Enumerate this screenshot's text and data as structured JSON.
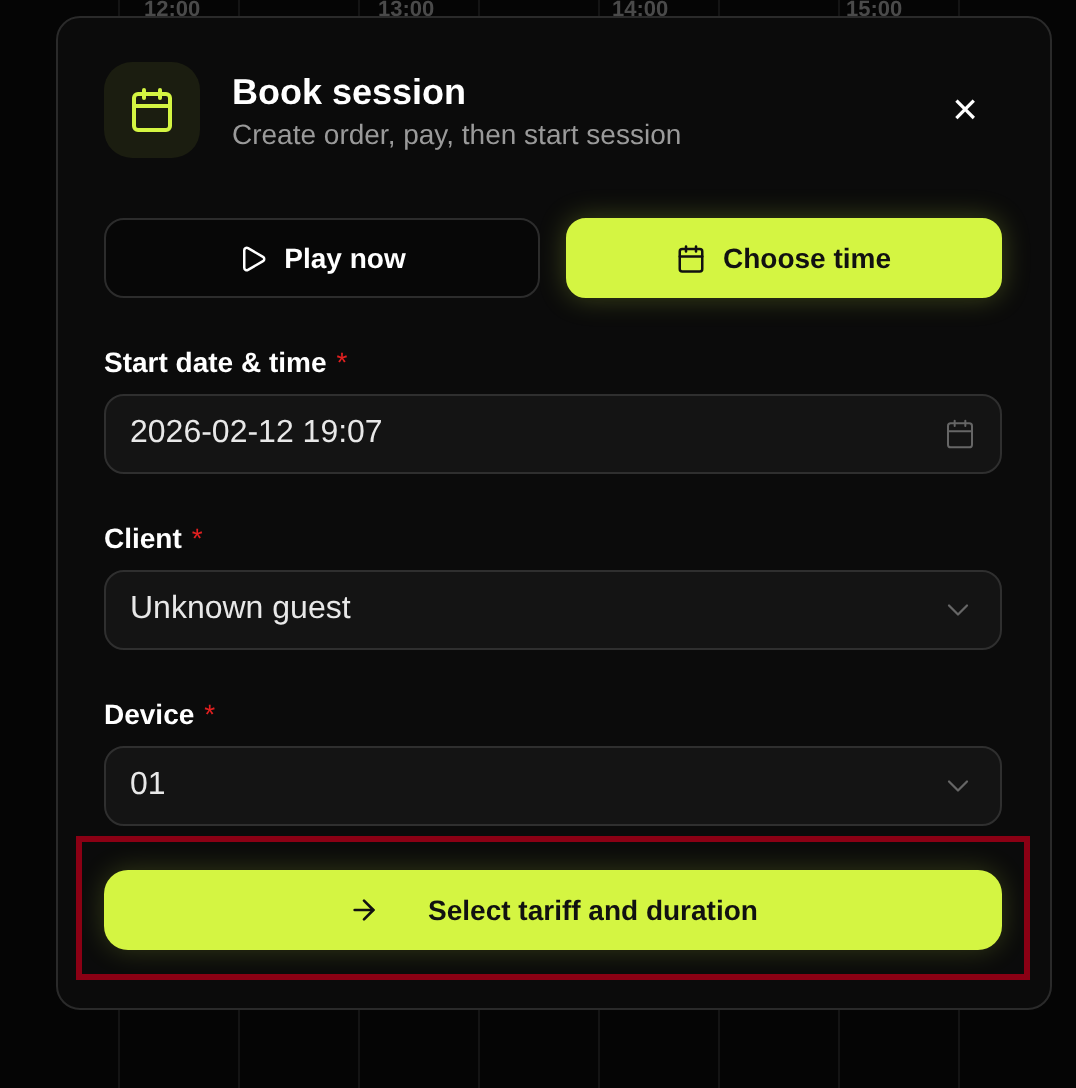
{
  "timeline": [
    "12:00",
    "13:00",
    "14:00",
    "15:00"
  ],
  "dialog": {
    "title": "Book session",
    "subtitle": "Create order, pay, then start session",
    "close": "×"
  },
  "modes": [
    {
      "label": "Play now",
      "kind": "play",
      "selected": false
    },
    {
      "label": "Choose time",
      "kind": "calendar",
      "selected": true
    }
  ],
  "fields": [
    {
      "label": "Start date & time",
      "required_mark": "*",
      "kind": "datetime",
      "value": "2026-02-12 19:07"
    },
    {
      "label": "Client",
      "required_mark": "*",
      "kind": "select",
      "value": "Unknown guest"
    },
    {
      "label": "Device",
      "required_mark": "*",
      "kind": "select",
      "value": "01"
    }
  ],
  "submit": {
    "label": "Select tariff and duration",
    "highlighted": true
  }
}
